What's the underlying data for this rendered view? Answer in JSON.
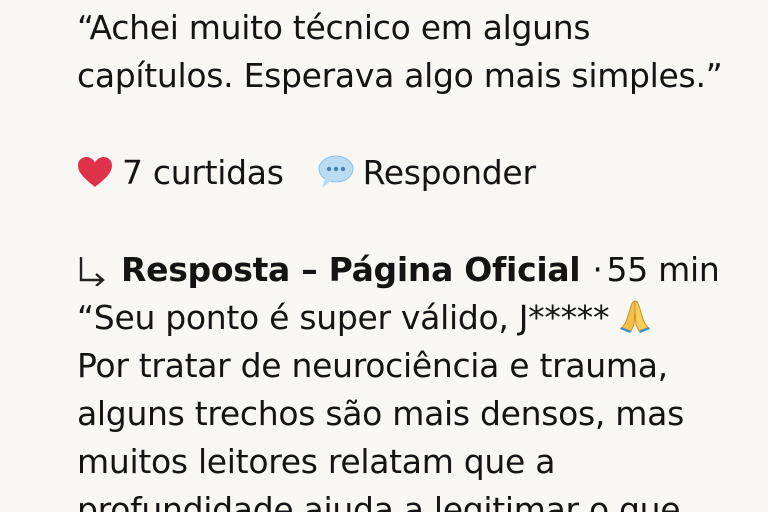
{
  "comment": {
    "line1": "“Achei muito técnico em alguns",
    "line2": "capítulos. Esperava algo mais simples.”"
  },
  "actions": {
    "likes_label": "7 curtidas",
    "reply_label": "Responder",
    "like_icon": "heart-icon",
    "reply_icon": "speech-bubble-icon",
    "heart_color": "#e0314a",
    "bubble_color": "#b9dcf3"
  },
  "reply": {
    "arrow_icon": "reply-arrow-icon",
    "author": "Resposta – Página Oficial",
    "separator": "·",
    "time": "55 min",
    "line1": "“Seu ponto é super válido, J*****",
    "emoji": "folded-hands-icon",
    "line2": "Por tratar de neurociência e trauma,",
    "line3": "alguns trechos são mais densos, mas",
    "line4": "muitos leitores relatam que a",
    "line5": "profundidade ajuda a legitimar o que"
  }
}
